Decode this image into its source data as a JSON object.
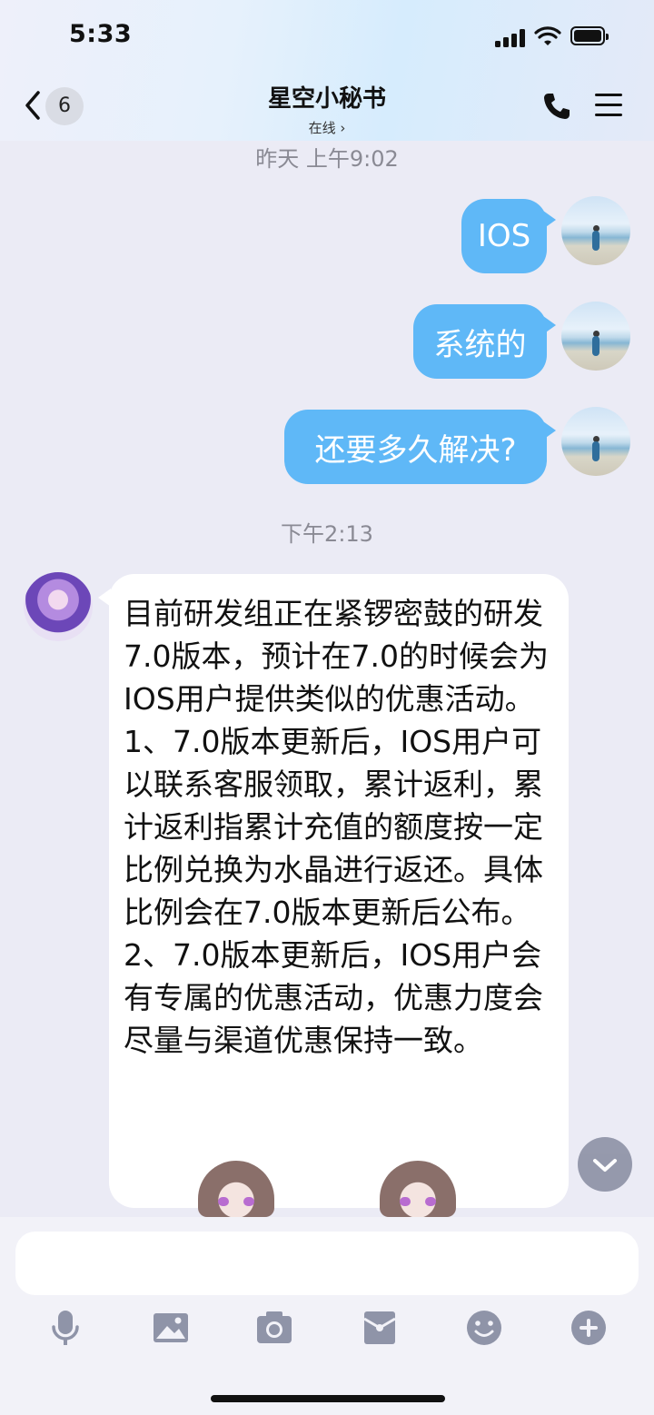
{
  "status_bar": {
    "time": "5:33"
  },
  "header": {
    "back_count": "6",
    "title": "星空小秘书",
    "subtitle": "在线 ›"
  },
  "messages": {
    "timestamp_1": "昨天 上午9:02",
    "out_1": "IOS",
    "out_2": "系统的",
    "out_3": "还要多久解决?",
    "timestamp_2": "下午2:13",
    "in_1": {
      "p1": "目前研发组正在紧锣密鼓的研发7.0版本，预计在7.0的时候会为IOS用户提供类似的优惠活动。",
      "p2": "1、7.0版本更新后，IOS用户可以联系客服领取，累计返利，累计返利指累计充值的额度按一定比例兑换为水晶进行返还。具体比例会在7.0版本更新后公布。",
      "p3": "2、7.0版本更新后，IOS用户会有专属的优惠活动，优惠力度会尽量与渠道优惠保持一致。"
    }
  },
  "input": {
    "value": "",
    "placeholder": ""
  },
  "toolbar": {
    "icons": [
      "microphone-icon",
      "image-icon",
      "camera-icon",
      "red-packet-icon",
      "emoji-icon",
      "plus-icon"
    ]
  },
  "colors": {
    "outgoing_bubble": "#5fb8f7",
    "incoming_bubble": "#ffffff",
    "background": "#ebebf5"
  }
}
